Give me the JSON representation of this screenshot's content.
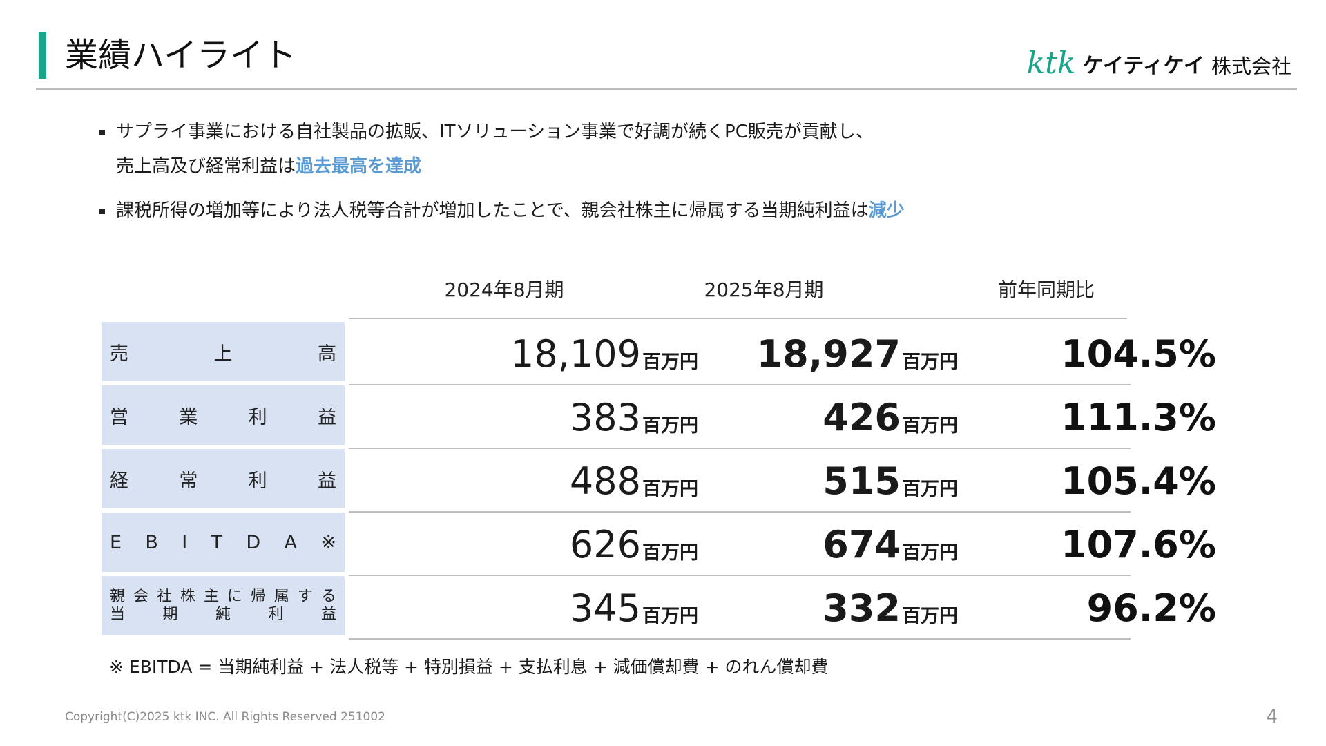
{
  "colors": {
    "accent_bar": "#1aa58a",
    "logo_green": "#1aa58a",
    "highlight_blue": "#5b9bd5",
    "label_fill": "#d9e2f3",
    "rule_gray": "#bdbdbd"
  },
  "header": {
    "title": "業績ハイライト",
    "logo": {
      "brand": "ktk",
      "kana": "ケイティケイ",
      "corp": "株式会社"
    }
  },
  "bullets": [
    {
      "text_1": "サプライ事業における自社製品の拡販、ITソリューション事業で好調が続くPC販売が貢献し、",
      "text_2": "売上高及び経常利益は",
      "highlight": "過去最高を達成"
    },
    {
      "text": "課税所得の増加等により法人税等合計が増加したことで、親会社株主に帰属する当期純利益は",
      "highlight": "減少"
    }
  ],
  "table": {
    "headers": {
      "prev": "2024年8月期",
      "curr": "2025年8月期",
      "ratio": "前年同期比"
    },
    "unit": "百万円",
    "rows": [
      {
        "label": [
          "売",
          "上",
          "高"
        ],
        "prev": "18,109",
        "curr": "18,927",
        "ratio": "104.5%"
      },
      {
        "label": [
          "営",
          "業",
          "利",
          "益"
        ],
        "prev": "383",
        "curr": "426",
        "ratio": "111.3%"
      },
      {
        "label": [
          "経",
          "常",
          "利",
          "益"
        ],
        "prev": "488",
        "curr": "515",
        "ratio": "105.4%"
      },
      {
        "label": [
          "E",
          "B",
          "I",
          "T",
          "D",
          "A",
          "※"
        ],
        "prev": "626",
        "curr": "674",
        "ratio": "107.6%"
      },
      {
        "label_line1": [
          "親",
          "会",
          "社",
          "株",
          "主",
          "に",
          "帰",
          "属",
          "す",
          "る"
        ],
        "label_line2": [
          "当",
          "期",
          "純",
          "利",
          "益"
        ],
        "prev": "345",
        "curr": "332",
        "ratio": "96.2%"
      }
    ]
  },
  "footnote": "※ EBITDA = 当期純利益 + 法人税等 + 特別損益 + 支払利息 + 減価償却費 + のれん償却費",
  "footer": {
    "copyright": "Copyright(C)2025 ktk INC. All Rights Reserved  251002",
    "page_number": "4"
  }
}
